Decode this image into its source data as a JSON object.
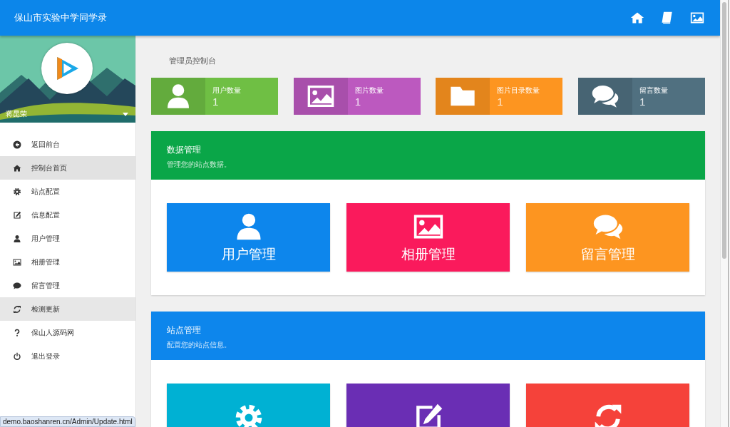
{
  "header": {
    "title": "保山市实验中学同学录",
    "icons": [
      {
        "kind": "home"
      },
      {
        "kind": "book"
      },
      {
        "kind": "picture"
      }
    ]
  },
  "sidebar": {
    "profile": {
      "name": "蒋昆荣"
    },
    "items": [
      {
        "label": "返回前台",
        "kind": "back",
        "selected": false,
        "hovered": false
      },
      {
        "label": "控制台首页",
        "kind": "home",
        "selected": true,
        "hovered": false
      },
      {
        "label": "站点配置",
        "kind": "gear",
        "selected": false,
        "hovered": false
      },
      {
        "label": "信息配置",
        "kind": "edit",
        "selected": false,
        "hovered": false
      },
      {
        "label": "用户管理",
        "kind": "user",
        "selected": false,
        "hovered": false
      },
      {
        "label": "相册管理",
        "kind": "picture",
        "selected": false,
        "hovered": false
      },
      {
        "label": "留言管理",
        "kind": "comment",
        "selected": false,
        "hovered": false
      },
      {
        "label": "检测更新",
        "kind": "refresh",
        "selected": false,
        "hovered": true
      },
      {
        "label": "保山人源码网",
        "kind": "question",
        "selected": false,
        "hovered": false
      },
      {
        "label": "退出登录",
        "kind": "power",
        "selected": false,
        "hovered": false
      }
    ]
  },
  "page_title": "管理员控制台",
  "stats": [
    {
      "label": "用户数量",
      "value": "1",
      "kind": "user",
      "color": "#6fbf44"
    },
    {
      "label": "图片数量",
      "value": "1",
      "kind": "picture",
      "color": "#bc59bf"
    },
    {
      "label": "图片目录数量",
      "value": "1",
      "kind": "folder",
      "color": "#fd9520"
    },
    {
      "label": "留言数量",
      "value": "1",
      "kind": "comments",
      "color": "#507080"
    }
  ],
  "panels": [
    {
      "title": "数据管理",
      "subtitle": "管理您的站点数据。",
      "color": "#0aa648",
      "tiles": [
        {
          "label": "用户管理",
          "kind": "user",
          "color": "#0d86ec"
        },
        {
          "label": "相册管理",
          "kind": "picture",
          "color": "#fa1a5c"
        },
        {
          "label": "留言管理",
          "kind": "comments",
          "color": "#fd9520"
        }
      ]
    },
    {
      "title": "站点管理",
      "subtitle": "配置您的站点信息。",
      "color": "#0d86ec",
      "tiles": [
        {
          "kind": "gear",
          "color": "#00b1d3"
        },
        {
          "kind": "edit",
          "color": "#6a2eb4"
        },
        {
          "kind": "refresh",
          "color": "#f5423a"
        }
      ]
    }
  ],
  "status_url": "demo.baoshanren.cn/Admin/Update.html"
}
